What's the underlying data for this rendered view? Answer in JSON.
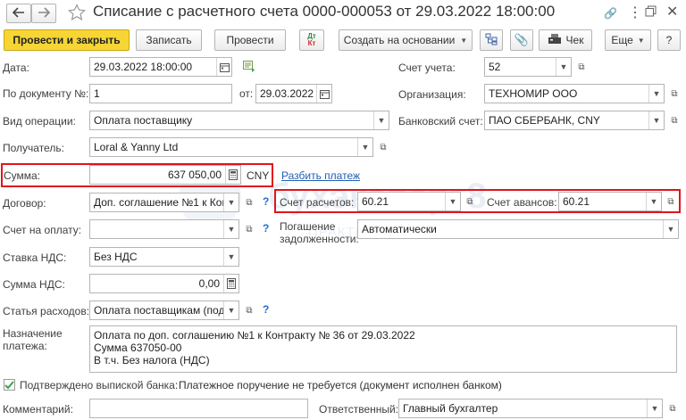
{
  "header": {
    "title": "Списание с расчетного счета 0000-000053 от 29.03.2022 18:00:00",
    "back_icon": "arrow-left",
    "forward_icon": "arrow-right",
    "star_icon": "star",
    "menu_icon": "dots-vertical",
    "restore_icon": "window-restore",
    "close_icon": "close"
  },
  "toolbar": {
    "post_close": "Провести и закрыть",
    "save": "Записать",
    "post": "Провести",
    "dtkt_top": "Дт",
    "dtkt_bottom": "Кт",
    "create_based": "Создать на основании",
    "check": "Чек",
    "more": "Еще",
    "help": "?"
  },
  "form": {
    "date_label": "Дата:",
    "date_value": "29.03.2022 18:00:00",
    "doc_num_label": "По документу №:",
    "doc_num_value": "1",
    "doc_from_label": "от:",
    "doc_from_value": "29.03.2022",
    "operation_label": "Вид операции:",
    "operation_value": "Оплата поставщику",
    "recipient_label": "Получатель:",
    "recipient_value": "Loral & Yanny Ltd",
    "amount_label": "Сумма:",
    "amount_value": "637 050,00",
    "amount_currency": "CNY",
    "split_link": "Разбить платеж",
    "contract_label": "Договор:",
    "contract_value": "Доп. соглашение №1 к Конт",
    "invoice_label": "Счет на оплату:",
    "invoice_value": "",
    "vat_rate_label": "Ставка НДС:",
    "vat_rate_value": "Без НДС",
    "vat_sum_label": "Сумма НДС:",
    "vat_sum_value": "0,00",
    "expense_label": "Статья расходов:",
    "expense_value": "Оплата поставщикам (подр",
    "purpose_label": "Назначение платежа:",
    "purpose_lines": [
      "Оплата по доп. соглашению №1 к Контракту № 36 от 29.03.2022",
      "Сумма 637050-00",
      "В т.ч. Без налога (НДС)"
    ],
    "confirmed_label": "Подтверждено выпиской банка:",
    "confirmed_checked": true,
    "confirmed_note": "Платежное поручение не требуется (документ исполнен банком)",
    "comment_label": "Комментарий:",
    "comment_value": "",
    "responsible_label": "Ответственный:",
    "responsible_value": "Главный бухгалтер",
    "account_label": "Счет учета:",
    "account_value": "52",
    "org_label": "Организация:",
    "org_value": "ТЕХНОМИР ООО",
    "bank_label": "Банковский счет:",
    "bank_value": "ПАО СБЕРБАНК, CNY",
    "settle_acc_label": "Счет расчетов:",
    "settle_acc_value": "60.21",
    "advance_acc_label": "Счет авансов:",
    "advance_acc_value": "60.21",
    "debt_repay_label_1": "Погашение",
    "debt_repay_label_2": "задолженности:",
    "debt_repay_value": "Автоматически"
  },
  "watermark": {
    "line1": "бухэксперт8",
    "line2": "ПРАКТИКА ПО УЧЕТУ В 1С"
  },
  "colors": {
    "primary_button": "#f6d535",
    "highlight_border": "#e0141e",
    "link": "#1f5fb5",
    "check_green": "#3aa14b"
  }
}
